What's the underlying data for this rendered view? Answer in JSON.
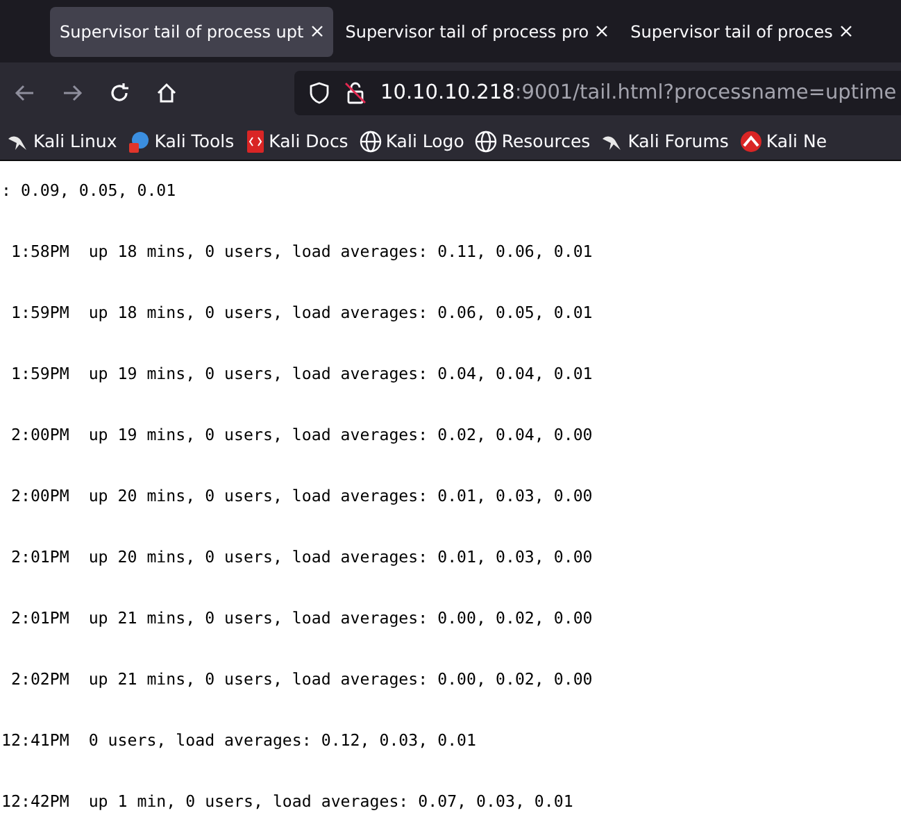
{
  "tabs": [
    {
      "title": "Supervisor tail of process upt",
      "selected": true
    },
    {
      "title": "Supervisor tail of process pro",
      "selected": false
    },
    {
      "title": "Supervisor tail of proces",
      "selected": false
    }
  ],
  "address": {
    "host": "10.10.10.218",
    "path": ":9001/tail.html?processname=uptime"
  },
  "bookmarks": [
    {
      "label": "Kali Linux",
      "kind": "dragon"
    },
    {
      "label": "Kali Tools",
      "kind": "tools"
    },
    {
      "label": "Kali Docs",
      "kind": "docs"
    },
    {
      "label": "Kali Logo",
      "kind": "globe"
    },
    {
      "label": "Resources",
      "kind": "globe"
    },
    {
      "label": "Kali Forums",
      "kind": "dragon"
    },
    {
      "label": "Kali Ne",
      "kind": "nethunter"
    }
  ],
  "log_lines": [
    ": 0.09, 0.05, 0.01",
    " 1:58PM  up 18 mins, 0 users, load averages: 0.11, 0.06, 0.01",
    " 1:59PM  up 18 mins, 0 users, load averages: 0.06, 0.05, 0.01",
    " 1:59PM  up 19 mins, 0 users, load averages: 0.04, 0.04, 0.01",
    " 2:00PM  up 19 mins, 0 users, load averages: 0.02, 0.04, 0.00",
    " 2:00PM  up 20 mins, 0 users, load averages: 0.01, 0.03, 0.00",
    " 2:01PM  up 20 mins, 0 users, load averages: 0.01, 0.03, 0.00",
    " 2:01PM  up 21 mins, 0 users, load averages: 0.00, 0.02, 0.00",
    " 2:02PM  up 21 mins, 0 users, load averages: 0.00, 0.02, 0.00",
    "12:41PM  0 users, load averages: 0.12, 0.03, 0.01",
    "12:42PM  up 1 min, 0 users, load averages: 0.07, 0.03, 0.01"
  ]
}
